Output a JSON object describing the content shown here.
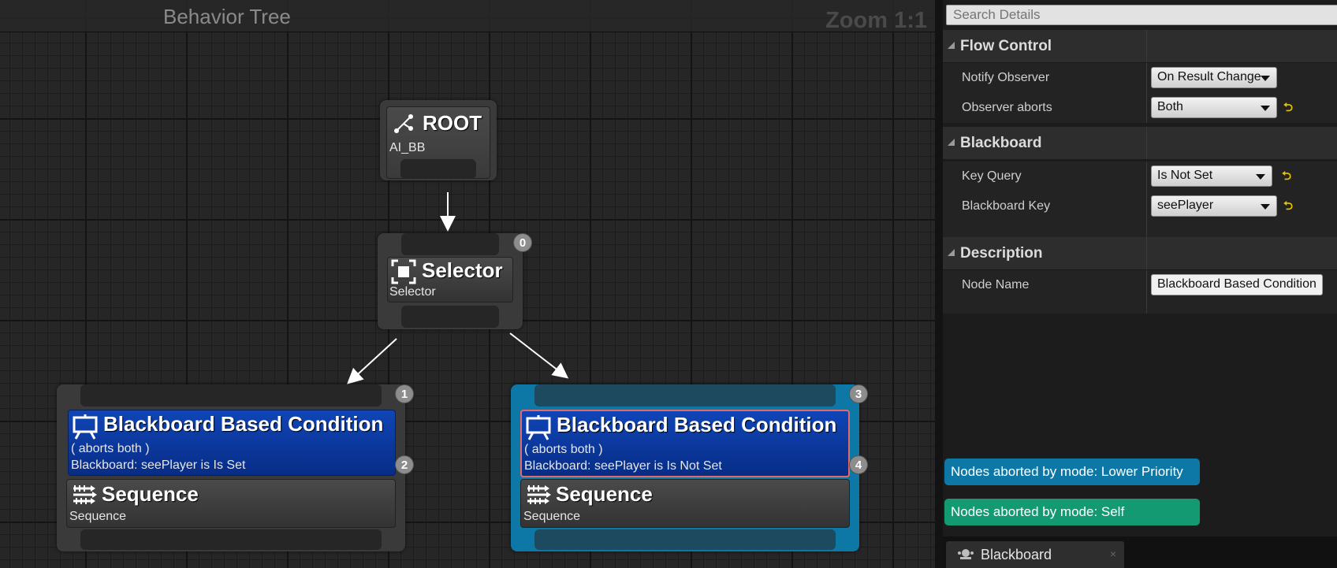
{
  "graph": {
    "title": "Behavior Tree",
    "zoom": "Zoom 1:1"
  },
  "nodes": {
    "root": {
      "title": "ROOT",
      "subtitle": "AI_BB"
    },
    "selector": {
      "title": "Selector",
      "subtitle": "Selector",
      "index": "0"
    },
    "left_branch": {
      "index": "1",
      "decorator": {
        "title": "Blackboard Based Condition",
        "line1": "( aborts both )",
        "line2": "Blackboard: seePlayer is Is Set",
        "index": "2"
      },
      "sequence": {
        "title": "Sequence",
        "subtitle": "Sequence"
      }
    },
    "right_branch": {
      "index": "3",
      "decorator": {
        "title": "Blackboard Based Condition",
        "line1": "( aborts both )",
        "line2": "Blackboard: seePlayer is Is Not Set",
        "index": "4"
      },
      "sequence": {
        "title": "Sequence",
        "subtitle": "Sequence"
      }
    }
  },
  "details": {
    "search_placeholder": "Search Details",
    "flow_control": {
      "label": "Flow Control",
      "notify_observer": {
        "label": "Notify Observer",
        "value": "On Result Change"
      },
      "observer_aborts": {
        "label": "Observer aborts",
        "value": "Both"
      }
    },
    "blackboard": {
      "label": "Blackboard",
      "key_query": {
        "label": "Key Query",
        "value": "Is Not Set"
      },
      "blackboard_key": {
        "label": "Blackboard Key",
        "value": "seePlayer"
      }
    },
    "description": {
      "label": "Description",
      "node_name": {
        "label": "Node Name",
        "value": "Blackboard Based Condition"
      }
    },
    "legend": {
      "lower_priority": "Nodes aborted by mode: Lower Priority",
      "self": "Nodes aborted by mode: Self"
    },
    "tab": {
      "label": "Blackboard",
      "close": "×"
    }
  },
  "colors": {
    "active_branch": "#0d78a6",
    "decorator": "#0a3a9e",
    "selection_outline": "#e36a6a",
    "legend_lower_priority": "#0d78a6",
    "legend_self": "#149a73",
    "reset_arrow": "#e8c400"
  }
}
